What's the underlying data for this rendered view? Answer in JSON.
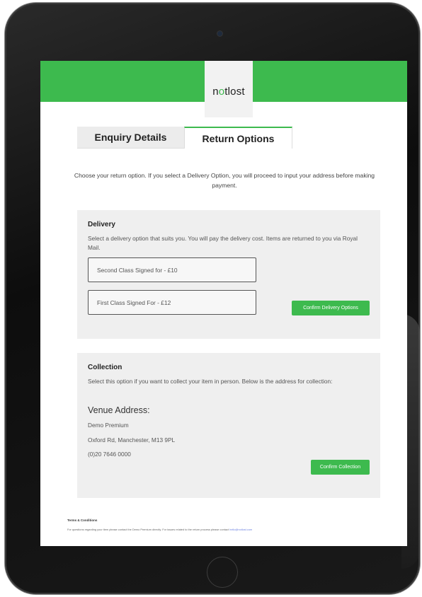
{
  "brand": {
    "logo_pre": "n",
    "logo_o": "o",
    "logo_post": "tlost",
    "accent": "#3dba4e"
  },
  "tabs": [
    {
      "label": "Enquiry Details",
      "active": false
    },
    {
      "label": "Return Options",
      "active": true
    }
  ],
  "intro": "Choose your return option. If you select a Delivery Option, you will proceed to input your address before making payment.",
  "delivery": {
    "title": "Delivery",
    "description": "Select a delivery option that suits you. You will pay the delivery cost. Items are returned to you via Royal Mail.",
    "options": [
      "Second Class Signed for - £10",
      "First Class Signed For - £12"
    ],
    "confirm_label": "Confirm Delivery Options"
  },
  "collection": {
    "title": "Collection",
    "description": "Select this option if you want to collect your item in person. Below is the address for collection:",
    "venue_title": "Venue Address:",
    "venue_name": "Demo Premium",
    "venue_address": "Oxford Rd, Manchester, M13 9PL",
    "venue_phone": "(0)20 7646 0000",
    "confirm_label": "Confirm Collection"
  },
  "footer": {
    "title": "Terms & Conditions",
    "text": "For questions regarding your item please contact the Demo Premium directly. For issues related to the return process please contact ",
    "email": "hello@notlost.com"
  }
}
